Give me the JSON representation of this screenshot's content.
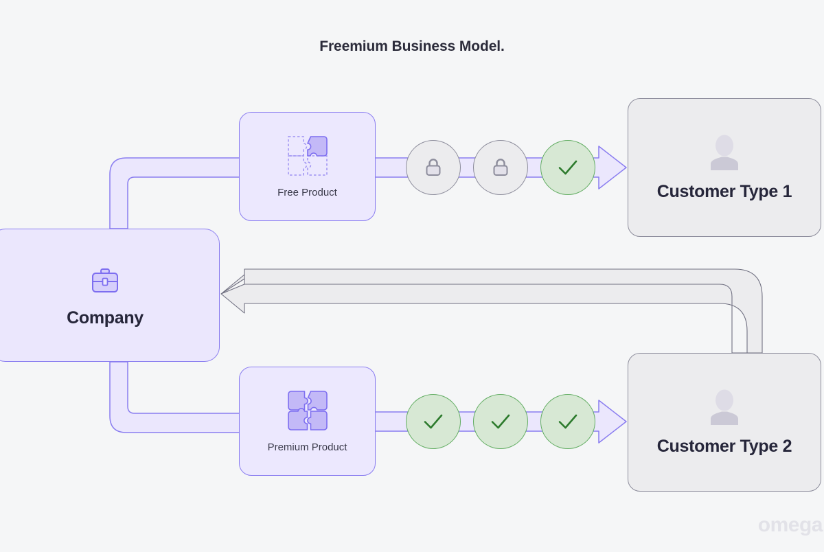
{
  "title": "Freemium Business Model.",
  "watermark": "omega",
  "colors": {
    "background": "#f5f6f7",
    "purple_fill": "#ebe7fd",
    "purple_stroke": "#8a7df0",
    "gray_fill": "#ececee",
    "gray_stroke": "#8d8d9c",
    "green_fill": "#d7e8d4",
    "green_stroke": "#62ad62",
    "green_check": "#2c7a2c",
    "text": "#26263a"
  },
  "nodes": {
    "company": {
      "label": "Company",
      "icon": "briefcase-icon"
    },
    "free_product": {
      "label": "Free Product",
      "icon": "puzzle-partial-icon"
    },
    "premium_product": {
      "label": "Premium Product",
      "icon": "puzzle-complete-icon"
    },
    "customer_type_1": {
      "label": "Customer Type 1",
      "icon": "person-icon"
    },
    "customer_type_2": {
      "label": "Customer Type 2",
      "icon": "person-icon"
    }
  },
  "feature_rows": [
    {
      "row": "free-product-features",
      "features": [
        {
          "state": "locked",
          "icon": "lock-icon"
        },
        {
          "state": "locked",
          "icon": "lock-icon"
        },
        {
          "state": "included",
          "icon": "check-icon"
        }
      ]
    },
    {
      "row": "premium-product-features",
      "features": [
        {
          "state": "included",
          "icon": "check-icon"
        },
        {
          "state": "included",
          "icon": "check-icon"
        },
        {
          "state": "included",
          "icon": "check-icon"
        }
      ]
    }
  ],
  "edges": [
    {
      "name": "company-to-free-product",
      "from": "company",
      "to": "free_product",
      "style": "purple"
    },
    {
      "name": "free-product-to-customer-type-1",
      "from": "free_product",
      "to": "customer_type_1",
      "style": "purple-arrow"
    },
    {
      "name": "company-to-premium-product",
      "from": "company",
      "to": "premium_product",
      "style": "purple"
    },
    {
      "name": "premium-product-to-customer-type-2",
      "from": "premium_product",
      "to": "customer_type_2",
      "style": "purple-arrow"
    },
    {
      "name": "customer-type-2-to-company",
      "from": "customer_type_2",
      "to": "company",
      "style": "gray-arrow"
    }
  ]
}
